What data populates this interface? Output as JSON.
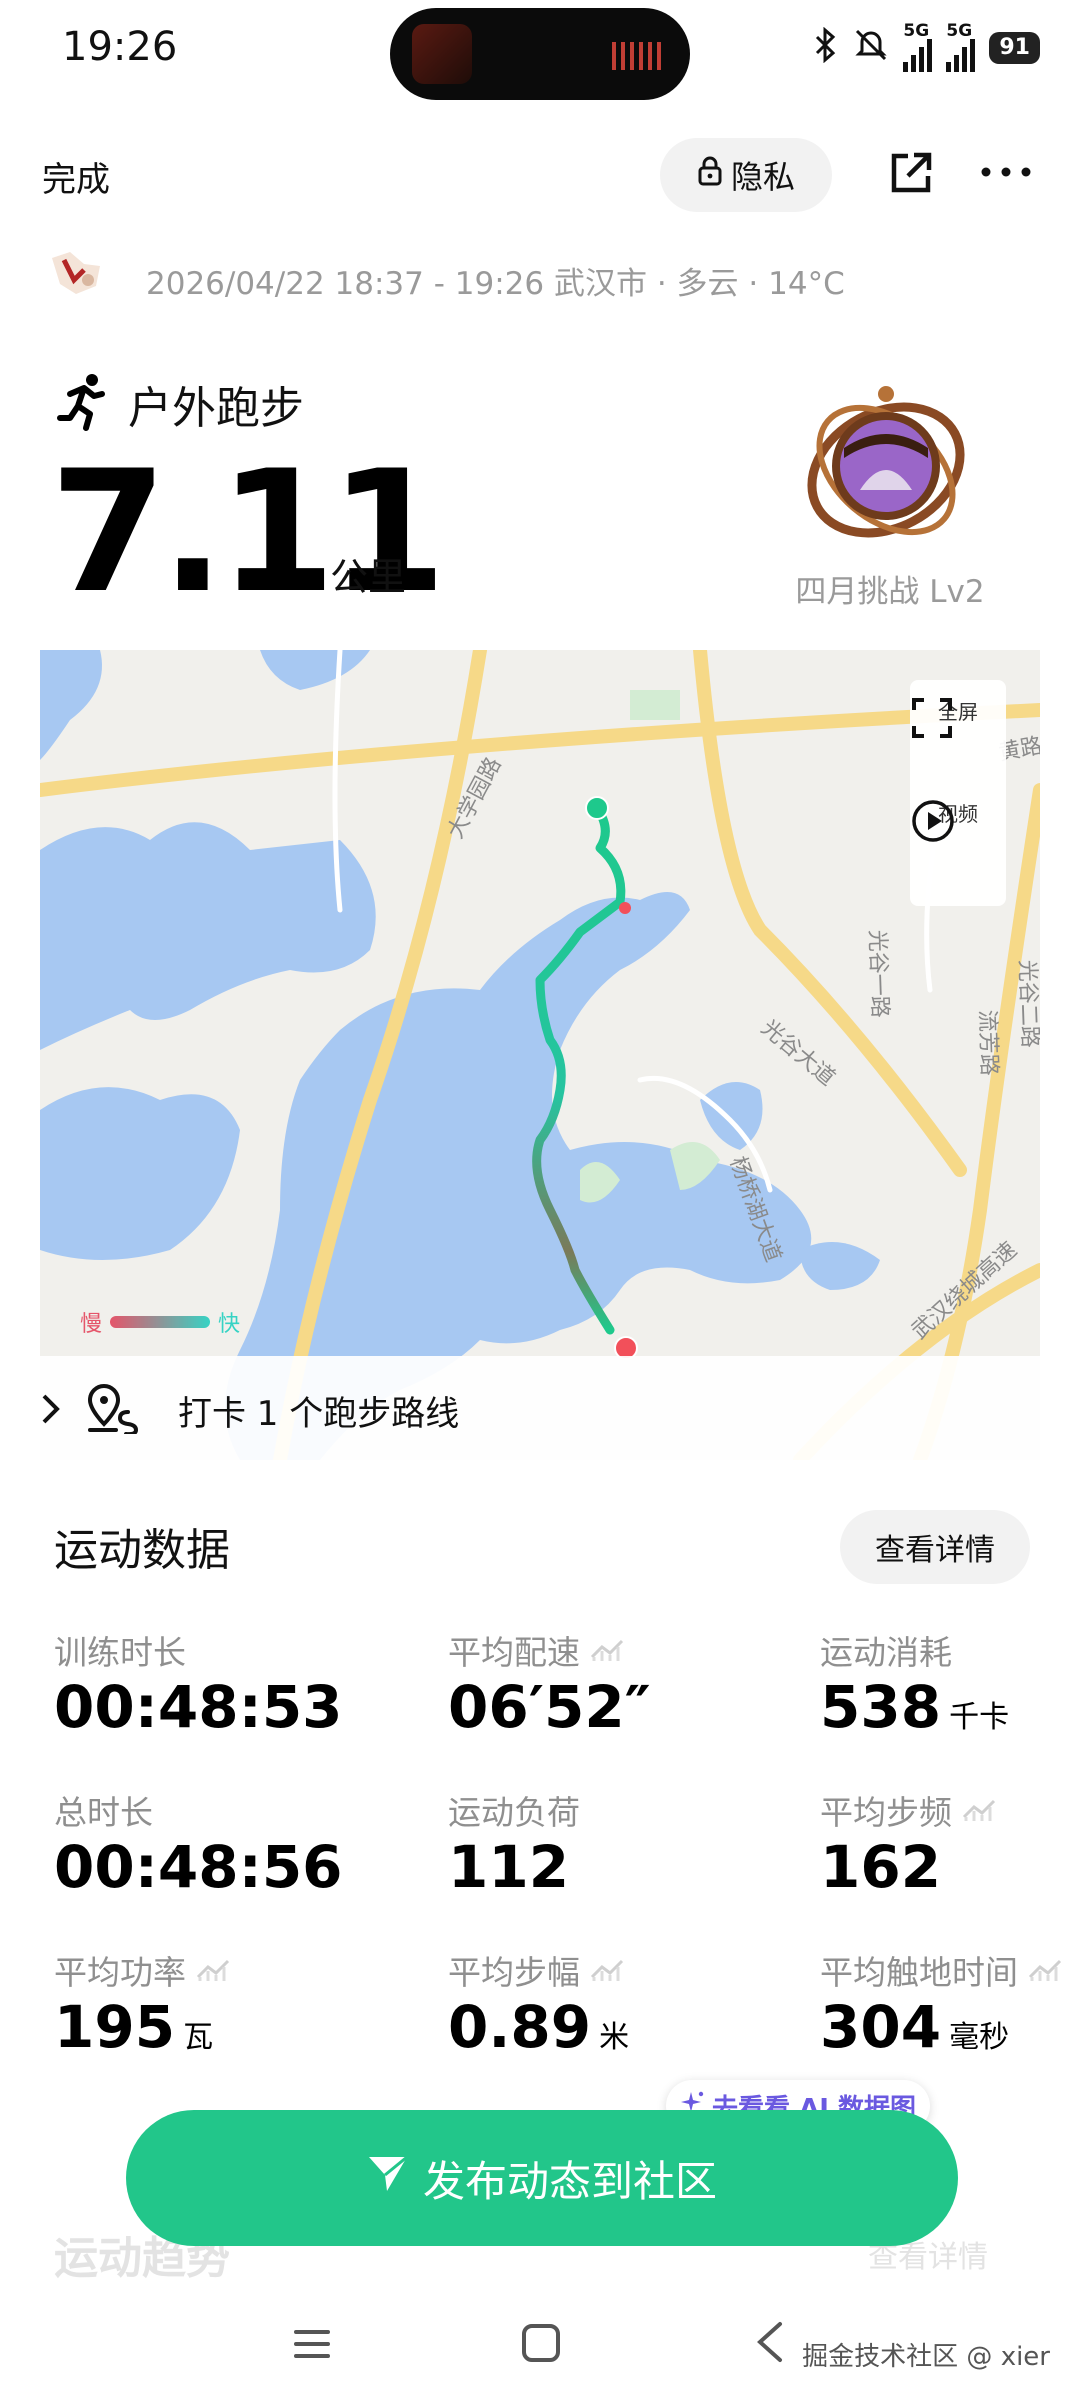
{
  "status_bar": {
    "time": "19:26",
    "network_1": "5G",
    "network_2": "5G",
    "battery": "91",
    "icons": [
      "bluetooth-icon",
      "mute-icon",
      "signal-icon",
      "signal-icon",
      "battery-icon"
    ]
  },
  "header": {
    "done_label": "完成",
    "privacy_label": "隐私",
    "icons": [
      "lock-icon",
      "share-icon",
      "more-icon"
    ]
  },
  "meta": {
    "datetime": "2026/04/22 18:37 - 19:26",
    "city": "武汉市",
    "weather": "多云",
    "temperature": "14°C",
    "separator": "·"
  },
  "activity": {
    "type": "户外跑步",
    "distance": "7.11",
    "unit": "公里",
    "badge_label": "四月挑战 Lv2"
  },
  "map": {
    "fullscreen_label": "全屏",
    "video_label": "视频",
    "legend_slow": "慢",
    "legend_fast": "快",
    "route_checkin": "打卡 1 个跑步路线",
    "road_labels": [
      "大学园路",
      "光谷一路",
      "光谷大道",
      "流芳路",
      "光谷二路",
      "杨桥湖大道",
      "武汉绕城高速",
      "黄路"
    ],
    "colors": {
      "route_start": "#1ec98c",
      "route_end": "#f2505a",
      "water": "#a7c8f2",
      "road": "#f6d988"
    }
  },
  "stats": {
    "title": "运动数据",
    "detail_label": "查看详情",
    "items": [
      {
        "label": "训练时长",
        "value": "00:48:53",
        "unit": ""
      },
      {
        "label": "平均配速",
        "value": "06′52″",
        "unit": ""
      },
      {
        "label": "运动消耗",
        "value": "538",
        "unit": "千卡"
      },
      {
        "label": "总时长",
        "value": "00:48:56",
        "unit": ""
      },
      {
        "label": "运动负荷",
        "value": "112",
        "unit": ""
      },
      {
        "label": "平均步频",
        "value": "162",
        "unit": ""
      },
      {
        "label": "平均功率",
        "value": "195",
        "unit": "瓦"
      },
      {
        "label": "平均步幅",
        "value": "0.89",
        "unit": "米"
      },
      {
        "label": "平均触地时间",
        "value": "304",
        "unit": "毫秒"
      }
    ]
  },
  "ai_chip": "去看看 AI 数据图",
  "publish_label": "发布动态到社区",
  "trend": {
    "title": "运动趋势",
    "detail_label": "查看详情"
  },
  "watermark": "掘金技术社区 @ xier",
  "colors": {
    "primary_green": "#22c68a",
    "muted_text": "#9a9a9a",
    "ai_purple": "#6a59e0"
  }
}
